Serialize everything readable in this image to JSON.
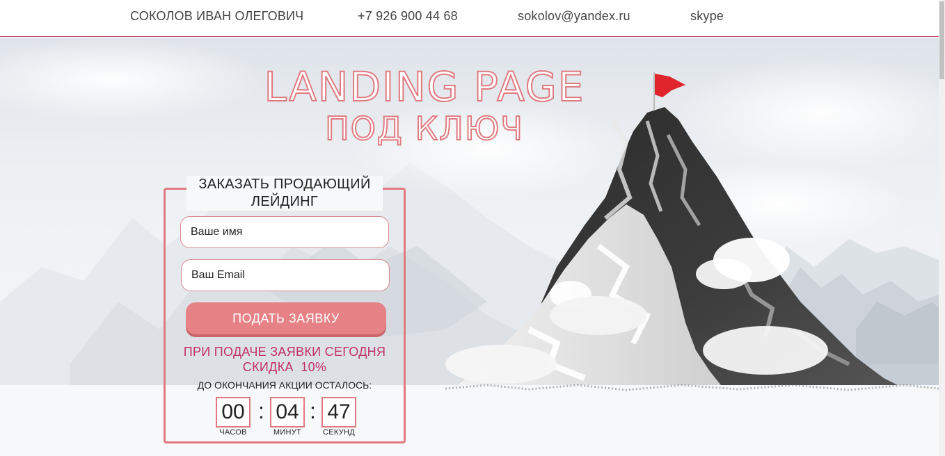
{
  "header": {
    "name": "СОКОЛОВ ИВАН ОЛЕГОВИЧ",
    "phone": "+7 926 900 44 68",
    "email": "sokolov@yandex.ru",
    "skype": "skype"
  },
  "hero": {
    "title_line1": "LANDING PAGE",
    "title_line2": "ПОД КЛЮЧ"
  },
  "form": {
    "title": "ЗАКАЗАТЬ ПРОДАЮЩИЙ ЛЕЙДИНГ",
    "name_placeholder": "Ваше имя",
    "email_placeholder": "Ваш Email",
    "submit_label": "ПОДАТЬ ЗАЯВКУ",
    "promo_line1": "ПРИ ПОДАЧЕ ЗАЯВКИ СЕГОДНЯ",
    "promo_line2": "СКИДКА  10%",
    "countdown_label": "ДО ОКОНЧАНИЯ АКЦИИ ОСТАЛОСЬ:"
  },
  "timer": {
    "hours": "00",
    "minutes": "04",
    "seconds": "47",
    "hours_label": "ЧАСОВ",
    "minutes_label": "МИНУТ",
    "seconds_label": "СЕКУНД",
    "separator": ":"
  },
  "colors": {
    "accent": "#e07a80",
    "button": "#e68185",
    "promo_text": "#c2306a",
    "flag": "#e0242c",
    "header_border": "#c44d6e"
  },
  "icons": {
    "flag": "flag-icon",
    "mountain": "mountain-image"
  }
}
